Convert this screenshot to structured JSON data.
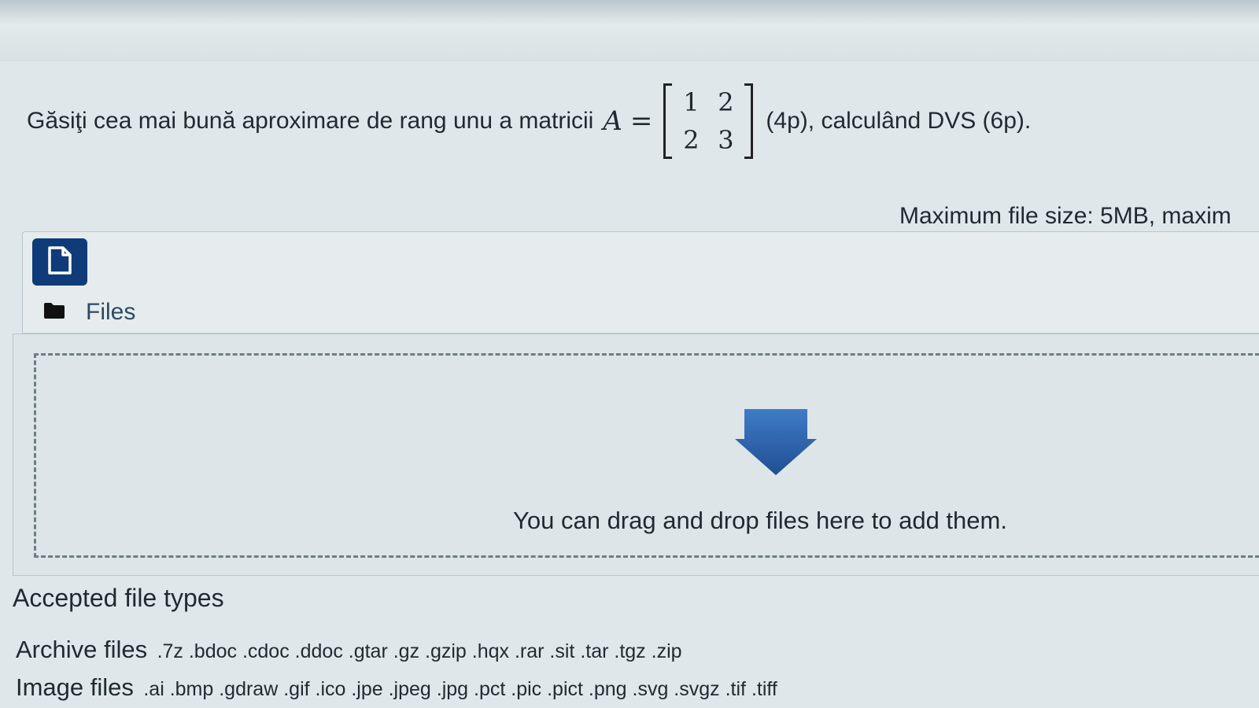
{
  "question": {
    "text_before": "Găsiţi cea mai bună aproximare de rang unu a matricii",
    "matrix_name": "A",
    "equals": "=",
    "matrix": [
      [
        "1",
        "2"
      ],
      [
        "2",
        "3"
      ]
    ],
    "text_after": "(4p), calculând DVS (6p)."
  },
  "filepicker": {
    "max_size_text": "Maximum file size: 5MB, maxim",
    "files_label": "Files",
    "drop_text": "You can drag and drop files here to add them."
  },
  "accepted": {
    "title": "Accepted file types",
    "archive_label": "Archive files",
    "archive_exts": ".7z .bdoc .cdoc .ddoc .gtar .gz .gzip .hqx .rar .sit .tar .tgz .zip",
    "image_label": "Image files",
    "image_exts": ".ai .bmp .gdraw .gif .ico .jpe .jpeg .jpg .pct .pic .pict .png .svg .svgz .tif .tiff"
  },
  "colors": {
    "button_bg": "#0f3b79",
    "arrow": "#2c67b1"
  },
  "icons": {
    "add_file": "file-icon",
    "folder": "folder-icon",
    "drop": "arrow-down-icon"
  }
}
